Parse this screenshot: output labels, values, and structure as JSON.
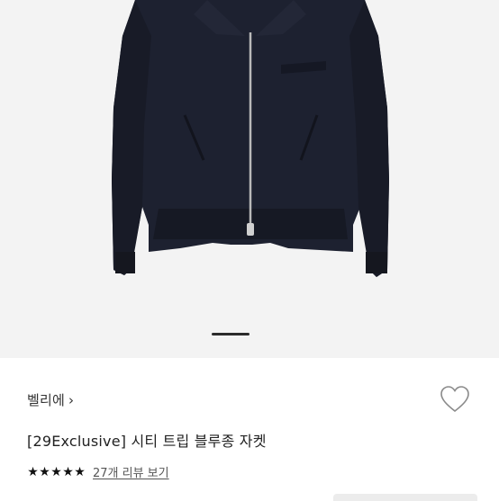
{
  "product": {
    "brand": "벨리에",
    "brand_chevron": "›",
    "title": "[29Exclusive] 시티 트립 블루종 자켓",
    "rating_stars": 5,
    "review_link": "27개 리뷰 보기",
    "image_index": 1
  },
  "icons": {
    "wishlist": "heart-outline-icon",
    "star": "star-icon",
    "brand_chevron": "chevron-right-icon"
  },
  "colors": {
    "jacket": "#1c1f2b",
    "background": "#f3f3f3",
    "star": "#111111"
  }
}
